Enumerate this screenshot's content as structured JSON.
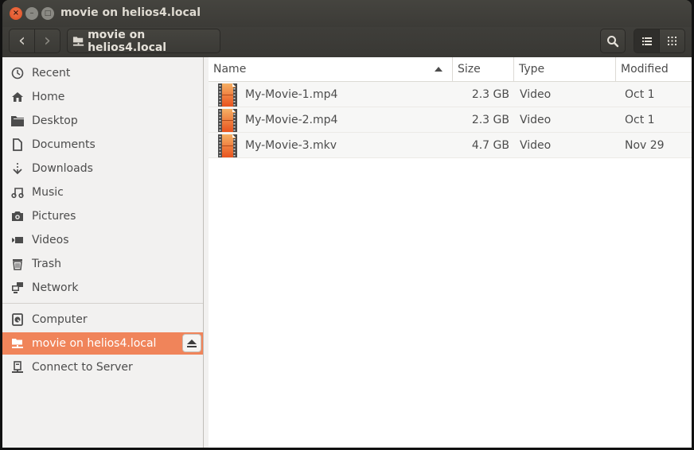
{
  "window": {
    "title": "movie on helios4.local",
    "controls": {
      "close": "×",
      "minimize": "–",
      "maximize": "□"
    }
  },
  "toolbar": {
    "back_icon": "‹",
    "forward_icon": "›",
    "path_label": "movie on helios4.local",
    "path_icon": "network-folder-icon",
    "search_icon": "search-icon",
    "view_list_icon": "list-view-icon",
    "view_grid_icon": "grid-view-icon",
    "active_view": "list"
  },
  "sidebar": {
    "places": [
      {
        "label": "Recent",
        "icon": "clock-icon"
      },
      {
        "label": "Home",
        "icon": "home-icon"
      },
      {
        "label": "Desktop",
        "icon": "folder-icon"
      },
      {
        "label": "Documents",
        "icon": "document-icon"
      },
      {
        "label": "Downloads",
        "icon": "download-icon"
      },
      {
        "label": "Music",
        "icon": "music-icon"
      },
      {
        "label": "Pictures",
        "icon": "camera-icon"
      },
      {
        "label": "Videos",
        "icon": "video-icon"
      },
      {
        "label": "Trash",
        "icon": "trash-icon"
      },
      {
        "label": "Network",
        "icon": "network-icon"
      }
    ],
    "devices": [
      {
        "label": "Computer",
        "icon": "harddisk-icon"
      },
      {
        "label": "movie on helios4.local",
        "icon": "network-folder-icon",
        "active": true,
        "eject": true
      },
      {
        "label": "Connect to Server",
        "icon": "server-icon"
      }
    ],
    "colors": {
      "active_bg": "#f0845a"
    }
  },
  "table": {
    "columns": {
      "name": "Name",
      "size": "Size",
      "type": "Type",
      "modified": "Modified"
    },
    "sort": {
      "column": "Name",
      "direction": "ascending"
    },
    "rows": [
      {
        "name": "My-Movie-1.mp4",
        "size": "2.3 GB",
        "type": "Video",
        "modified": "Oct 1"
      },
      {
        "name": "My-Movie-2.mp4",
        "size": "2.3 GB",
        "type": "Video",
        "modified": "Oct 1"
      },
      {
        "name": "My-Movie-3.mkv",
        "size": "4.7 GB",
        "type": "Video",
        "modified": "Nov 29"
      }
    ]
  }
}
